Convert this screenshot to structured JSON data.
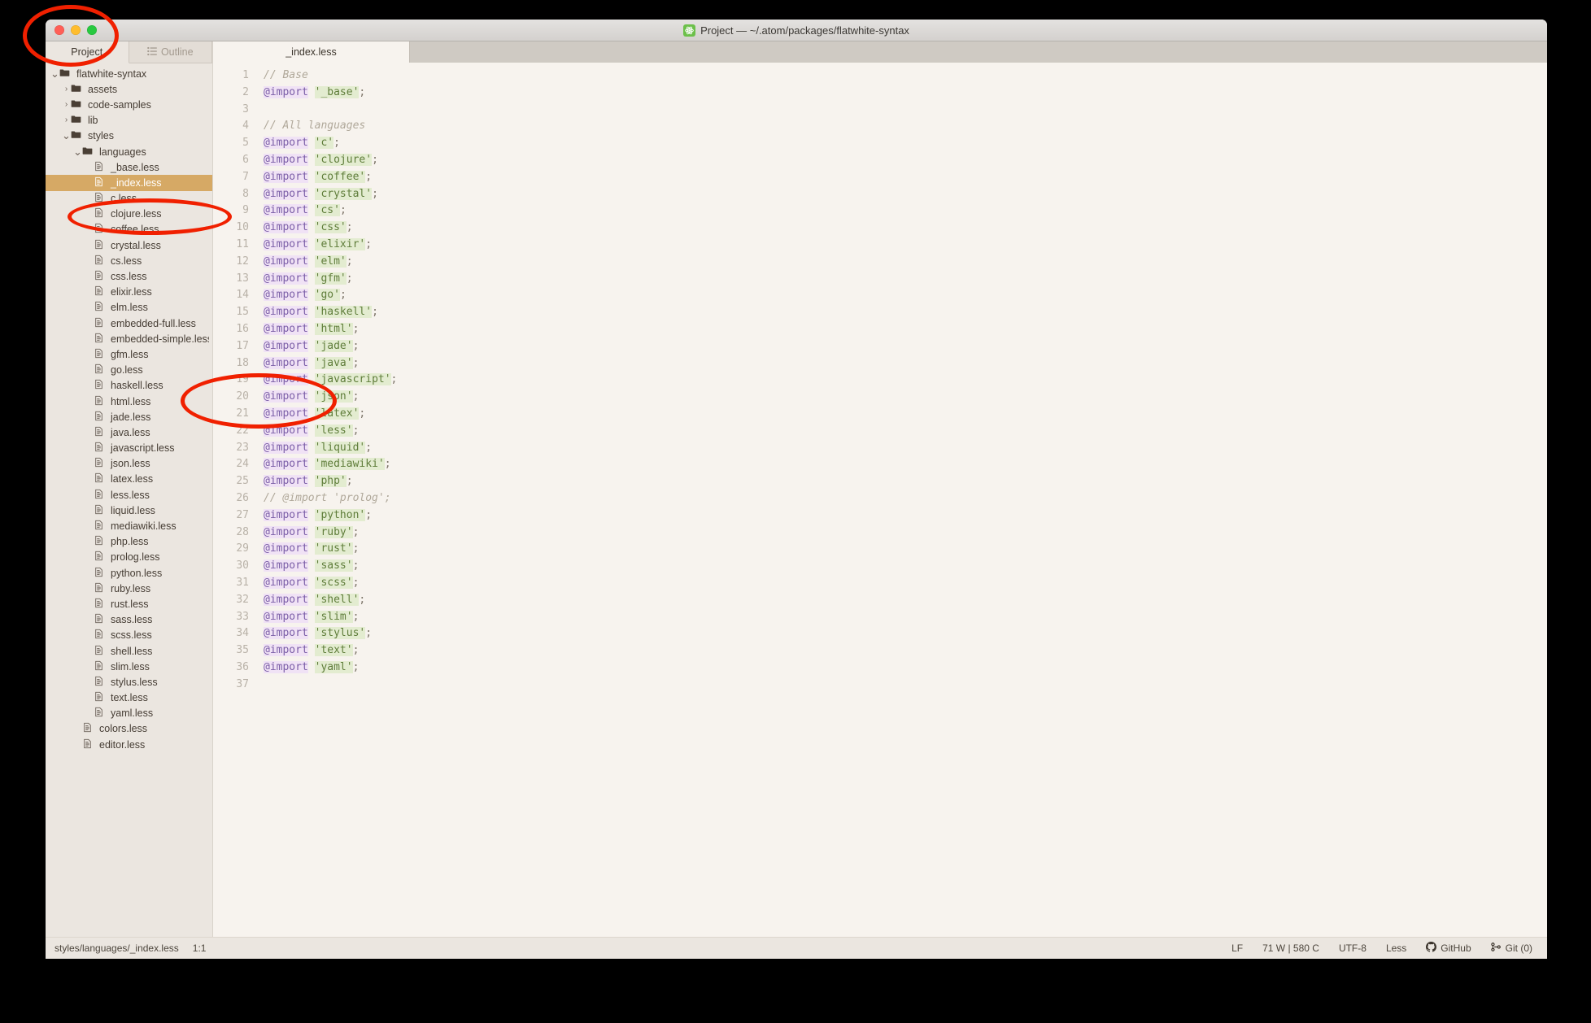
{
  "window": {
    "title": "Project — ~/.atom/packages/flatwhite-syntax",
    "app_icon": "atom-icon"
  },
  "traffic_lights": {
    "close": "close-button",
    "minimize": "minimize-button",
    "maximize": "maximize-button"
  },
  "dock": {
    "tabs": [
      {
        "label": "Project",
        "icon": "",
        "active": true
      },
      {
        "label": "Outline",
        "icon": "list-icon",
        "active": false
      }
    ]
  },
  "tree": [
    {
      "label": "flatwhite-syntax",
      "type": "folder",
      "depth": 0,
      "expanded": true
    },
    {
      "label": "assets",
      "type": "folder",
      "depth": 1,
      "expanded": false
    },
    {
      "label": "code-samples",
      "type": "folder",
      "depth": 1,
      "expanded": false
    },
    {
      "label": "lib",
      "type": "folder",
      "depth": 1,
      "expanded": false
    },
    {
      "label": "styles",
      "type": "folder",
      "depth": 1,
      "expanded": true
    },
    {
      "label": "languages",
      "type": "folder",
      "depth": 2,
      "expanded": true
    },
    {
      "label": "_base.less",
      "type": "file",
      "depth": 3
    },
    {
      "label": "_index.less",
      "type": "file",
      "depth": 3,
      "selected": true
    },
    {
      "label": "c.less",
      "type": "file",
      "depth": 3
    },
    {
      "label": "clojure.less",
      "type": "file",
      "depth": 3
    },
    {
      "label": "coffee.less",
      "type": "file",
      "depth": 3
    },
    {
      "label": "crystal.less",
      "type": "file",
      "depth": 3
    },
    {
      "label": "cs.less",
      "type": "file",
      "depth": 3
    },
    {
      "label": "css.less",
      "type": "file",
      "depth": 3
    },
    {
      "label": "elixir.less",
      "type": "file",
      "depth": 3
    },
    {
      "label": "elm.less",
      "type": "file",
      "depth": 3
    },
    {
      "label": "embedded-full.less",
      "type": "file",
      "depth": 3
    },
    {
      "label": "embedded-simple.less",
      "type": "file",
      "depth": 3
    },
    {
      "label": "gfm.less",
      "type": "file",
      "depth": 3
    },
    {
      "label": "go.less",
      "type": "file",
      "depth": 3
    },
    {
      "label": "haskell.less",
      "type": "file",
      "depth": 3
    },
    {
      "label": "html.less",
      "type": "file",
      "depth": 3
    },
    {
      "label": "jade.less",
      "type": "file",
      "depth": 3
    },
    {
      "label": "java.less",
      "type": "file",
      "depth": 3
    },
    {
      "label": "javascript.less",
      "type": "file",
      "depth": 3
    },
    {
      "label": "json.less",
      "type": "file",
      "depth": 3
    },
    {
      "label": "latex.less",
      "type": "file",
      "depth": 3
    },
    {
      "label": "less.less",
      "type": "file",
      "depth": 3
    },
    {
      "label": "liquid.less",
      "type": "file",
      "depth": 3
    },
    {
      "label": "mediawiki.less",
      "type": "file",
      "depth": 3
    },
    {
      "label": "php.less",
      "type": "file",
      "depth": 3
    },
    {
      "label": "prolog.less",
      "type": "file",
      "depth": 3
    },
    {
      "label": "python.less",
      "type": "file",
      "depth": 3
    },
    {
      "label": "ruby.less",
      "type": "file",
      "depth": 3
    },
    {
      "label": "rust.less",
      "type": "file",
      "depth": 3
    },
    {
      "label": "sass.less",
      "type": "file",
      "depth": 3
    },
    {
      "label": "scss.less",
      "type": "file",
      "depth": 3
    },
    {
      "label": "shell.less",
      "type": "file",
      "depth": 3
    },
    {
      "label": "slim.less",
      "type": "file",
      "depth": 3
    },
    {
      "label": "stylus.less",
      "type": "file",
      "depth": 3
    },
    {
      "label": "text.less",
      "type": "file",
      "depth": 3
    },
    {
      "label": "yaml.less",
      "type": "file",
      "depth": 3
    },
    {
      "label": "colors.less",
      "type": "file",
      "depth": 2
    },
    {
      "label": "editor.less",
      "type": "file",
      "depth": 2
    }
  ],
  "editor": {
    "tabs": [
      {
        "label": "_index.less",
        "active": true
      }
    ],
    "first_line": 1,
    "last_line": 37,
    "lines": [
      {
        "n": 1,
        "tokens": [
          {
            "t": "cmt",
            "v": "// Base"
          }
        ]
      },
      {
        "n": 2,
        "tokens": [
          {
            "t": "kw",
            "v": "@import"
          },
          {
            "t": "plain",
            "v": " "
          },
          {
            "t": "str",
            "v": "'_base'"
          },
          {
            "t": "punc",
            "v": ";"
          }
        ]
      },
      {
        "n": 3,
        "tokens": []
      },
      {
        "n": 4,
        "tokens": [
          {
            "t": "cmt",
            "v": "// All languages"
          }
        ]
      },
      {
        "n": 5,
        "tokens": [
          {
            "t": "kw",
            "v": "@import"
          },
          {
            "t": "plain",
            "v": " "
          },
          {
            "t": "str",
            "v": "'c'"
          },
          {
            "t": "punc",
            "v": ";"
          }
        ]
      },
      {
        "n": 6,
        "tokens": [
          {
            "t": "kw",
            "v": "@import"
          },
          {
            "t": "plain",
            "v": " "
          },
          {
            "t": "str",
            "v": "'clojure'"
          },
          {
            "t": "punc",
            "v": ";"
          }
        ]
      },
      {
        "n": 7,
        "tokens": [
          {
            "t": "kw",
            "v": "@import"
          },
          {
            "t": "plain",
            "v": " "
          },
          {
            "t": "str",
            "v": "'coffee'"
          },
          {
            "t": "punc",
            "v": ";"
          }
        ]
      },
      {
        "n": 8,
        "tokens": [
          {
            "t": "kw",
            "v": "@import"
          },
          {
            "t": "plain",
            "v": " "
          },
          {
            "t": "str",
            "v": "'crystal'"
          },
          {
            "t": "punc",
            "v": ";"
          }
        ]
      },
      {
        "n": 9,
        "tokens": [
          {
            "t": "kw",
            "v": "@import"
          },
          {
            "t": "plain",
            "v": " "
          },
          {
            "t": "str",
            "v": "'cs'"
          },
          {
            "t": "punc",
            "v": ";"
          }
        ]
      },
      {
        "n": 10,
        "tokens": [
          {
            "t": "kw",
            "v": "@import"
          },
          {
            "t": "plain",
            "v": " "
          },
          {
            "t": "str",
            "v": "'css'"
          },
          {
            "t": "punc",
            "v": ";"
          }
        ]
      },
      {
        "n": 11,
        "tokens": [
          {
            "t": "kw",
            "v": "@import"
          },
          {
            "t": "plain",
            "v": " "
          },
          {
            "t": "str",
            "v": "'elixir'"
          },
          {
            "t": "punc",
            "v": ";"
          }
        ]
      },
      {
        "n": 12,
        "tokens": [
          {
            "t": "kw",
            "v": "@import"
          },
          {
            "t": "plain",
            "v": " "
          },
          {
            "t": "str",
            "v": "'elm'"
          },
          {
            "t": "punc",
            "v": ";"
          }
        ]
      },
      {
        "n": 13,
        "tokens": [
          {
            "t": "kw",
            "v": "@import"
          },
          {
            "t": "plain",
            "v": " "
          },
          {
            "t": "str",
            "v": "'gfm'"
          },
          {
            "t": "punc",
            "v": ";"
          }
        ]
      },
      {
        "n": 14,
        "tokens": [
          {
            "t": "kw",
            "v": "@import"
          },
          {
            "t": "plain",
            "v": " "
          },
          {
            "t": "str",
            "v": "'go'"
          },
          {
            "t": "punc",
            "v": ";"
          }
        ]
      },
      {
        "n": 15,
        "tokens": [
          {
            "t": "kw",
            "v": "@import"
          },
          {
            "t": "plain",
            "v": " "
          },
          {
            "t": "str",
            "v": "'haskell'"
          },
          {
            "t": "punc",
            "v": ";"
          }
        ]
      },
      {
        "n": 16,
        "tokens": [
          {
            "t": "kw",
            "v": "@import"
          },
          {
            "t": "plain",
            "v": " "
          },
          {
            "t": "str",
            "v": "'html'"
          },
          {
            "t": "punc",
            "v": ";"
          }
        ]
      },
      {
        "n": 17,
        "tokens": [
          {
            "t": "kw",
            "v": "@import"
          },
          {
            "t": "plain",
            "v": " "
          },
          {
            "t": "str",
            "v": "'jade'"
          },
          {
            "t": "punc",
            "v": ";"
          }
        ]
      },
      {
        "n": 18,
        "tokens": [
          {
            "t": "kw",
            "v": "@import"
          },
          {
            "t": "plain",
            "v": " "
          },
          {
            "t": "str",
            "v": "'java'"
          },
          {
            "t": "punc",
            "v": ";"
          }
        ]
      },
      {
        "n": 19,
        "tokens": [
          {
            "t": "kw",
            "v": "@import"
          },
          {
            "t": "plain",
            "v": " "
          },
          {
            "t": "str",
            "v": "'javascript'"
          },
          {
            "t": "punc",
            "v": ";"
          }
        ]
      },
      {
        "n": 20,
        "tokens": [
          {
            "t": "kw",
            "v": "@import"
          },
          {
            "t": "plain",
            "v": " "
          },
          {
            "t": "str",
            "v": "'json'"
          },
          {
            "t": "punc",
            "v": ";"
          }
        ]
      },
      {
        "n": 21,
        "tokens": [
          {
            "t": "kw",
            "v": "@import"
          },
          {
            "t": "plain",
            "v": " "
          },
          {
            "t": "str",
            "v": "'latex'"
          },
          {
            "t": "punc",
            "v": ";"
          }
        ]
      },
      {
        "n": 22,
        "tokens": [
          {
            "t": "kw",
            "v": "@import"
          },
          {
            "t": "plain",
            "v": " "
          },
          {
            "t": "str",
            "v": "'less'"
          },
          {
            "t": "punc",
            "v": ";"
          }
        ]
      },
      {
        "n": 23,
        "tokens": [
          {
            "t": "kw",
            "v": "@import"
          },
          {
            "t": "plain",
            "v": " "
          },
          {
            "t": "str",
            "v": "'liquid'"
          },
          {
            "t": "punc",
            "v": ";"
          }
        ]
      },
      {
        "n": 24,
        "tokens": [
          {
            "t": "kw",
            "v": "@import"
          },
          {
            "t": "plain",
            "v": " "
          },
          {
            "t": "str",
            "v": "'mediawiki'"
          },
          {
            "t": "punc",
            "v": ";"
          }
        ]
      },
      {
        "n": 25,
        "tokens": [
          {
            "t": "kw",
            "v": "@import"
          },
          {
            "t": "plain",
            "v": " "
          },
          {
            "t": "str",
            "v": "'php'"
          },
          {
            "t": "punc",
            "v": ";"
          }
        ]
      },
      {
        "n": 26,
        "tokens": [
          {
            "t": "cmt",
            "v": "// @import 'prolog';"
          }
        ]
      },
      {
        "n": 27,
        "tokens": [
          {
            "t": "kw",
            "v": "@import"
          },
          {
            "t": "plain",
            "v": " "
          },
          {
            "t": "str",
            "v": "'python'"
          },
          {
            "t": "punc",
            "v": ";"
          }
        ]
      },
      {
        "n": 28,
        "tokens": [
          {
            "t": "kw",
            "v": "@import"
          },
          {
            "t": "plain",
            "v": " "
          },
          {
            "t": "str",
            "v": "'ruby'"
          },
          {
            "t": "punc",
            "v": ";"
          }
        ]
      },
      {
        "n": 29,
        "tokens": [
          {
            "t": "kw",
            "v": "@import"
          },
          {
            "t": "plain",
            "v": " "
          },
          {
            "t": "str",
            "v": "'rust'"
          },
          {
            "t": "punc",
            "v": ";"
          }
        ]
      },
      {
        "n": 30,
        "tokens": [
          {
            "t": "kw",
            "v": "@import"
          },
          {
            "t": "plain",
            "v": " "
          },
          {
            "t": "str",
            "v": "'sass'"
          },
          {
            "t": "punc",
            "v": ";"
          }
        ]
      },
      {
        "n": 31,
        "tokens": [
          {
            "t": "kw",
            "v": "@import"
          },
          {
            "t": "plain",
            "v": " "
          },
          {
            "t": "str",
            "v": "'scss'"
          },
          {
            "t": "punc",
            "v": ";"
          }
        ]
      },
      {
        "n": 32,
        "tokens": [
          {
            "t": "kw",
            "v": "@import"
          },
          {
            "t": "plain",
            "v": " "
          },
          {
            "t": "str",
            "v": "'shell'"
          },
          {
            "t": "punc",
            "v": ";"
          }
        ]
      },
      {
        "n": 33,
        "tokens": [
          {
            "t": "kw",
            "v": "@import"
          },
          {
            "t": "plain",
            "v": " "
          },
          {
            "t": "str",
            "v": "'slim'"
          },
          {
            "t": "punc",
            "v": ";"
          }
        ]
      },
      {
        "n": 34,
        "tokens": [
          {
            "t": "kw",
            "v": "@import"
          },
          {
            "t": "plain",
            "v": " "
          },
          {
            "t": "str",
            "v": "'stylus'"
          },
          {
            "t": "punc",
            "v": ";"
          }
        ]
      },
      {
        "n": 35,
        "tokens": [
          {
            "t": "kw",
            "v": "@import"
          },
          {
            "t": "plain",
            "v": " "
          },
          {
            "t": "str",
            "v": "'text'"
          },
          {
            "t": "punc",
            "v": ";"
          }
        ]
      },
      {
        "n": 36,
        "tokens": [
          {
            "t": "kw",
            "v": "@import"
          },
          {
            "t": "plain",
            "v": " "
          },
          {
            "t": "str",
            "v": "'yaml'"
          },
          {
            "t": "punc",
            "v": ";"
          }
        ]
      },
      {
        "n": 37,
        "tokens": []
      }
    ]
  },
  "statusbar": {
    "path": "styles/languages/_index.less",
    "cursor": "1:1",
    "line_ending": "LF",
    "counts": "71 W | 580 C",
    "encoding": "UTF-8",
    "grammar": "Less",
    "github": "GitHub",
    "git": "Git (0)"
  },
  "colors": {
    "selection": "#d6a965",
    "annotation": "#f02000",
    "editor_bg": "#f7f3ee",
    "sidebar_bg": "#ebe6e0",
    "keyword_bg": "#f0e2f5",
    "string_bg": "#e3ecd0"
  }
}
